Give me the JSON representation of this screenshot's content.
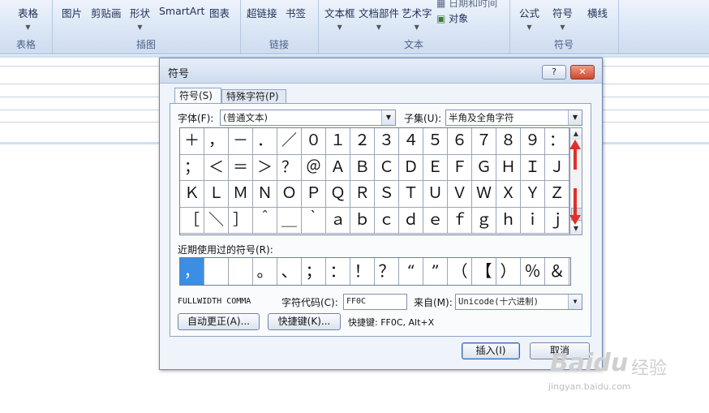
{
  "ribbon": {
    "groups": [
      {
        "title": "表格",
        "buttons": [
          "表格"
        ]
      },
      {
        "title": "插图",
        "buttons": [
          "图片",
          "剪贴画",
          "形状",
          "SmartArt",
          "图表"
        ]
      },
      {
        "title": "链接",
        "buttons": [
          "超链接",
          "书签"
        ]
      },
      {
        "title": "文本",
        "buttons": [
          "文本框",
          "文档部件",
          "艺术字"
        ],
        "small": [
          "日期和时间",
          "对象"
        ]
      },
      {
        "title": "符号",
        "buttons": [
          "公式",
          "符号",
          "横线"
        ]
      }
    ]
  },
  "dialog": {
    "title": "符号",
    "help_label": "?",
    "close_label": "✕",
    "tabs": [
      "符号(S)",
      "特殊字符(P)"
    ],
    "font_label": "字体(F):",
    "font_value": "(普通文本)",
    "subset_label": "子集(U):",
    "subset_value": "半角及全角字符",
    "symbols": [
      [
        "＋",
        "，",
        "－",
        "．",
        "／",
        "０",
        "１",
        "２",
        "３",
        "４",
        "５",
        "６",
        "７",
        "８",
        "９",
        "："
      ],
      [
        "；",
        "＜",
        "＝",
        "＞",
        "？",
        "＠",
        "Ａ",
        "Ｂ",
        "Ｃ",
        "Ｄ",
        "Ｅ",
        "Ｆ",
        "Ｇ",
        "Ｈ",
        "Ｉ",
        "Ｊ"
      ],
      [
        "Ｋ",
        "Ｌ",
        "Ｍ",
        "Ｎ",
        "Ｏ",
        "Ｐ",
        "Ｑ",
        "Ｒ",
        "Ｓ",
        "Ｔ",
        "Ｕ",
        "Ｖ",
        "Ｗ",
        "Ｘ",
        "Ｙ",
        "Ｚ"
      ],
      [
        "［",
        "＼",
        "］",
        "＾",
        "＿",
        "｀",
        "ａ",
        "ｂ",
        "ｃ",
        "ｄ",
        "ｅ",
        "ｆ",
        "ｇ",
        "ｈ",
        "ｉ",
        "ｊ"
      ]
    ],
    "recent_label": "近期使用过的符号(R):",
    "recent": [
      "，",
      "",
      "",
      "。",
      "、",
      "；",
      "：",
      "！",
      "？",
      "“",
      "”",
      "（",
      "【",
      "）",
      "％",
      "＆"
    ],
    "char_name": "FULLWIDTH COMMA",
    "char_code_label": "字符代码(C):",
    "char_code_value": "FF0C",
    "from_label": "来自(M):",
    "from_value": "Unicode(十六进制)",
    "autocorrect_label": "自动更正(A)...",
    "shortcut_key_label": "快捷键(K)...",
    "shortcut_text": "快捷键: FF0C, Alt+X",
    "insert_label": "插入(I)",
    "cancel_label": "取消"
  },
  "watermark": {
    "brand": "Baidu",
    "cn": "经验",
    "url": "jingyan.baidu.com"
  },
  "colors": {
    "selected_cell": "#3a8ee6",
    "arrow": "#e0302a"
  }
}
